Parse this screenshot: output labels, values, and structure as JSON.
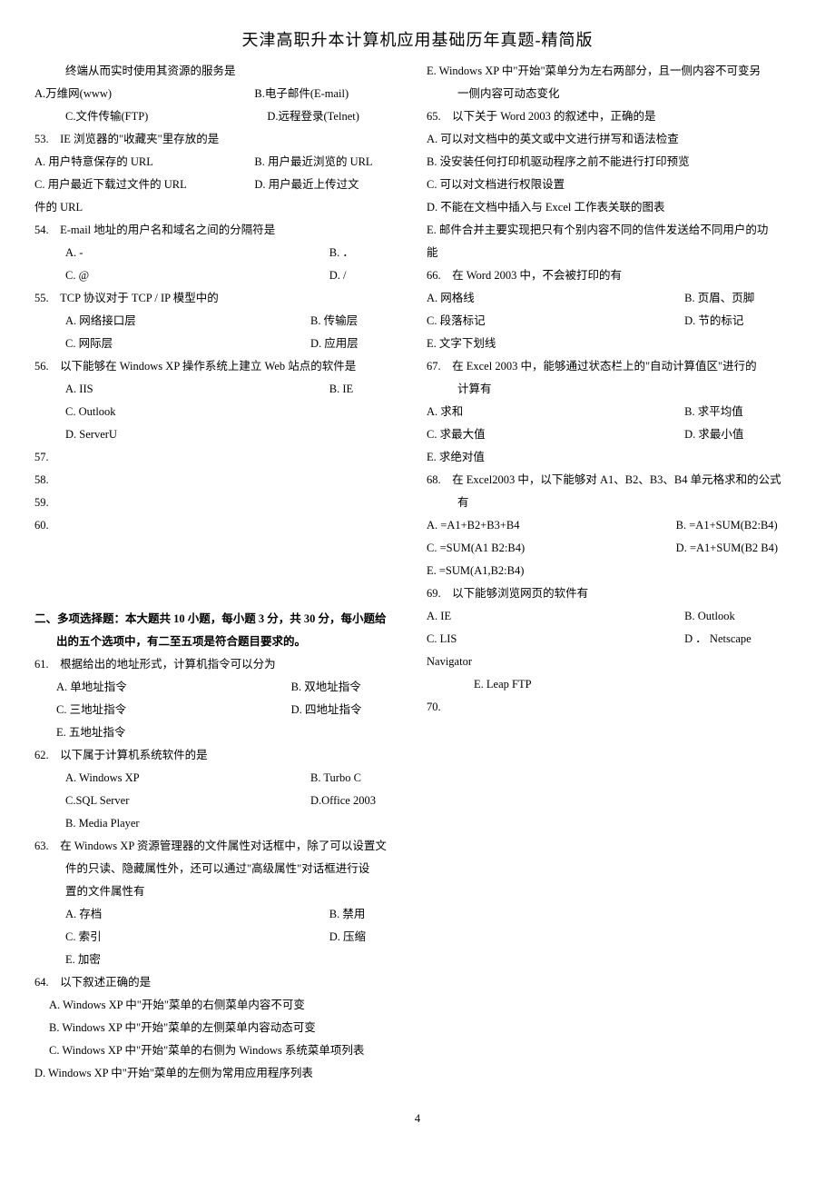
{
  "title": "天津高职升本计算机应用基础历年真题-精简版",
  "page_number": "4",
  "col1": {
    "pre": {
      "l1": "终端从而实时使用其资源的服务是",
      "r1a": "A.万维网(www)",
      "r1b": "B.电子邮件(E-mail)",
      "r2a": "C.文件传输(FTP)",
      "r2b": "D.远程登录(Telnet)"
    },
    "q53": {
      "stem": "53.　IE 浏览器的\"收藏夹\"里存放的是",
      "a": "A. 用户特意保存的 URL",
      "b": "B. 用户最近浏览的 URL",
      "c": "C. 用户最近下载过文件的 URL",
      "d": "D. 用户最近上传过文",
      "tail": "件的 URL"
    },
    "q54": {
      "stem": "54.　E-mail 地址的用户名和域名之间的分隔符是",
      "a": "A. -",
      "b": "B. ．",
      "c": "C. @",
      "d": "D. /"
    },
    "q55": {
      "stem": "55.　TCP 协议对于 TCP / IP 模型中的",
      "a": "A. 网络接口层",
      "b": "B. 传输层",
      "c": "C. 网际层",
      "d": "D. 应用层"
    },
    "q56": {
      "stem": "56.　以下能够在 Windows XP 操作系统上建立 Web 站点的软件是",
      "a": "A. IIS",
      "b": "B. IE",
      "c": "C. Outlook",
      "d": "D. ServerU"
    },
    "q57": "57.",
    "q58": "58.",
    "q59": "59.",
    "q60": "60.",
    "section2_l1": "二、多项选择题：本大题共 10 小题，每小题 3 分，共 30 分，每小题给",
    "section2_l2": "出的五个选项中，有二至五项是符合题目要求的。",
    "q61": {
      "stem": "61.　根据给出的地址形式，计算机指令可以分为",
      "a": "A. 单地址指令",
      "b": "B. 双地址指令",
      "c": "C. 三地址指令",
      "d": "D. 四地址指令",
      "e": "E. 五地址指令"
    },
    "q62": {
      "stem": "62.　以下属于计算机系统软件的是",
      "a": "A. Windows XP",
      "b": "B. Turbo C",
      "c": "C.SQL Server",
      "d": "D.Office 2003",
      "e": "B. Media Player"
    },
    "q63": {
      "stem1": "63.　在 Windows XP 资源管理器的文件属性对话框中，除了可以设置文",
      "stem2": "件的只读、隐藏属性外，还可以通过\"高级属性\"对话框进行设",
      "stem3": "置的文件属性有",
      "a": "A. 存档",
      "b": "B. 禁用",
      "c": "C. 索引",
      "d": "D. 压缩",
      "e": "E. 加密"
    },
    "q64": {
      "stem": "64.　以下叙述正确的是",
      "a": "A. Windows XP 中\"开始\"菜单的右侧菜单内容不可变",
      "b": "B. Windows XP 中\"开始\"菜单的左侧菜单内容动态可变",
      "c": "C. Windows XP 中\"开始\"菜单的右侧为 Windows 系统菜单项列表",
      "d": "D. Windows XP 中\"开始\"菜单的左侧为常用应用程序列表"
    }
  },
  "col2": {
    "q64e_l1": "E. Windows XP 中\"开始\"菜单分为左右两部分，且一侧内容不可变另",
    "q64e_l2": "一侧内容可动态变化",
    "q65": {
      "stem": "65.　以下关于 Word 2003 的叙述中，正确的是",
      "a": "A. 可以对文档中的英文或中文进行拼写和语法检查",
      "b": "B. 没安装任何打印机驱动程序之前不能进行打印预览",
      "c": "C. 可以对文档进行权限设置",
      "d": "D. 不能在文档中插入与 Excel 工作表关联的图表",
      "e1": "E. 邮件合并主要实现把只有个别内容不同的信件发送给不同用户的功",
      "e2": "能"
    },
    "q66": {
      "stem": "66.　在 Word 2003 中，不会被打印的有",
      "a": "A. 网格线",
      "b": "B. 页眉、页脚",
      "c": "C. 段落标记",
      "d": "D. 节的标记",
      "e": "E. 文字下划线"
    },
    "q67": {
      "stem1": "67.　在 Excel 2003 中，能够通过状态栏上的\"自动计算值区\"进行的",
      "stem2": "计算有",
      "a": "A. 求和",
      "b": "B. 求平均值",
      "c": "C. 求最大值",
      "d": "D. 求最小值",
      "e": "E. 求绝对值"
    },
    "q68": {
      "stem1": "68.　在 Excel2003 中，以下能够对 A1、B2、B3、B4 单元格求和的公式",
      "stem2": "有",
      "a": "A. =A1+B2+B3+B4",
      "b": "B. =A1+SUM(B2:B4)",
      "c": "C. =SUM(A1 B2:B4)",
      "d": "D. =A1+SUM(B2 B4)",
      "e": "E. =SUM(A1,B2:B4)"
    },
    "q69": {
      "stem": "69.　以下能够浏览网页的软件有",
      "a": "A. IE",
      "b": "B. Outlook",
      "c": "C. LIS",
      "d": "D ． Netscape",
      "nav": "Navigator",
      "e": "E. Leap FTP"
    },
    "q70": "70."
  }
}
